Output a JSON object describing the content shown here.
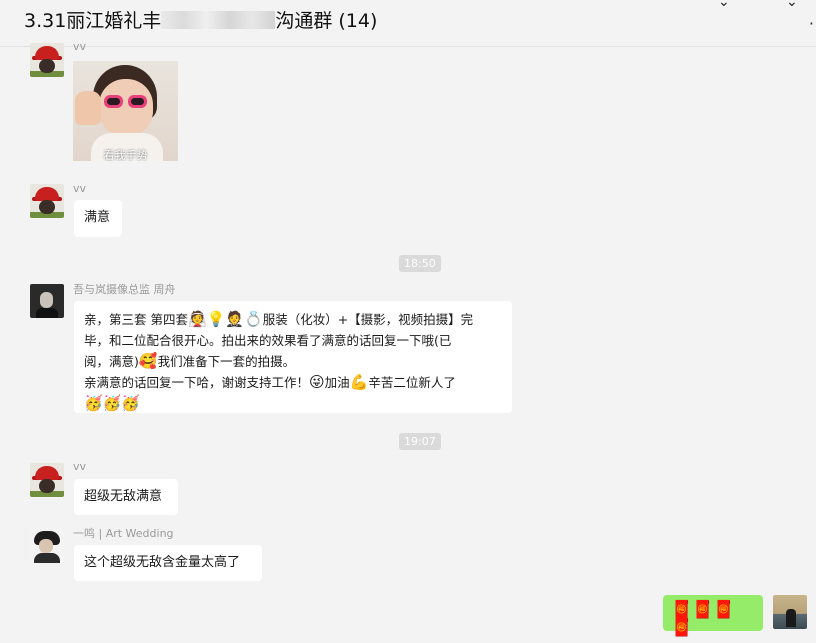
{
  "header": {
    "title_prefix": "3.31丽江婚礼丰",
    "title_suffix": "沟通群 (14)"
  },
  "messages": [
    {
      "sender": "vv",
      "type": "image",
      "caption": "看我手势"
    },
    {
      "sender": "vv",
      "text": "满意"
    },
    {
      "time": "18:50"
    },
    {
      "sender": "吾与岚摄像总监 周舟",
      "line1": "亲，第三套 第四套",
      "line1b": "服装（化妆）+【摄影，视频拍摄】完",
      "line2": "毕，和二位配合很开心。拍出来的效果看了满意的话回复一下哦(已",
      "line3a": "阅，满意)",
      "line3b": "我们准备下一套的拍摄。",
      "line4a": "亲满意的话回复一下哈，谢谢支持工作！",
      "line4b": "加油",
      "line4c": "辛苦二位新人了",
      "emojis_line1": "👰💡🤵💍",
      "emoji_smile": "🥰",
      "emoji_wink": "😜",
      "emoji_arm": "💪",
      "emojis_end": "🥳🥳🥳"
    },
    {
      "time": "19:07"
    },
    {
      "sender": "vv",
      "text": "超级无敌满意"
    },
    {
      "sender": "一鸣 | Art Wedding",
      "text": "这个超级无敌含金量太高了"
    },
    {
      "self": true,
      "emojis": "🧧🧧🧧🧧"
    }
  ],
  "colors": {
    "self_bubble": "#95ec69",
    "bubble": "#ffffff",
    "background": "#f3f3f3"
  }
}
